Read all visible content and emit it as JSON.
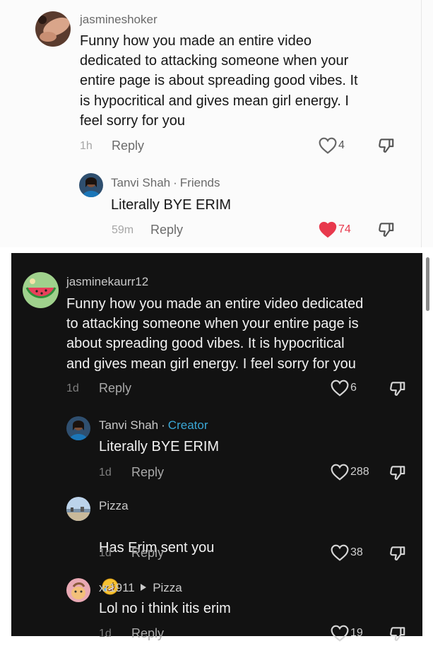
{
  "light_comments": [
    {
      "username": "jasmineshoker",
      "text": "Funny how you made an entire video\ndedicated to attacking someone when your\nentire page is about spreading good vibes. It\nis hypocritical and gives mean girl energy. I\nfeel sorry for you",
      "time": "1h",
      "reply_label": "Reply",
      "likes": "4",
      "liked": false
    },
    {
      "username": "Tanvi Shah",
      "badge": "Friends",
      "text": "Literally BYE ERIM",
      "time": "59m",
      "reply_label": "Reply",
      "likes": "74",
      "liked": true
    }
  ],
  "dark_comments": [
    {
      "username": "jasminekaurr12",
      "text": "Funny how you made an entire video dedicated\nto attacking someone when your entire page is\nabout spreading good vibes. It is hypocritical\nand gives mean girl energy. I feel sorry for you",
      "time": "1d",
      "reply_label": "Reply",
      "likes": "6"
    },
    {
      "username": "Tanvi Shah",
      "badge": "Creator",
      "text": "Literally BYE ERIM",
      "time": "1d",
      "reply_label": "Reply",
      "likes": "288"
    },
    {
      "username": "Pizza",
      "text": "Has Erim sent you",
      "emoji": "🤣",
      "time": "1d",
      "reply_label": "Reply",
      "likes": "38"
    },
    {
      "username": "xr1911",
      "reply_to": "Pizza",
      "text": "Lol no i think itis erim",
      "time": "1d",
      "reply_label": "Reply",
      "likes": "19"
    }
  ],
  "icons": {
    "like": "heart-outline-icon",
    "liked": "heart-filled-icon",
    "dislike": "thumbs-down-icon",
    "reply_arrow": "triangle-right-icon"
  },
  "colors": {
    "liked_heart": "#e8394d",
    "creator_badge": "#3aa7d6",
    "dark_background": "#121212",
    "light_background": "#fbfbfb"
  }
}
